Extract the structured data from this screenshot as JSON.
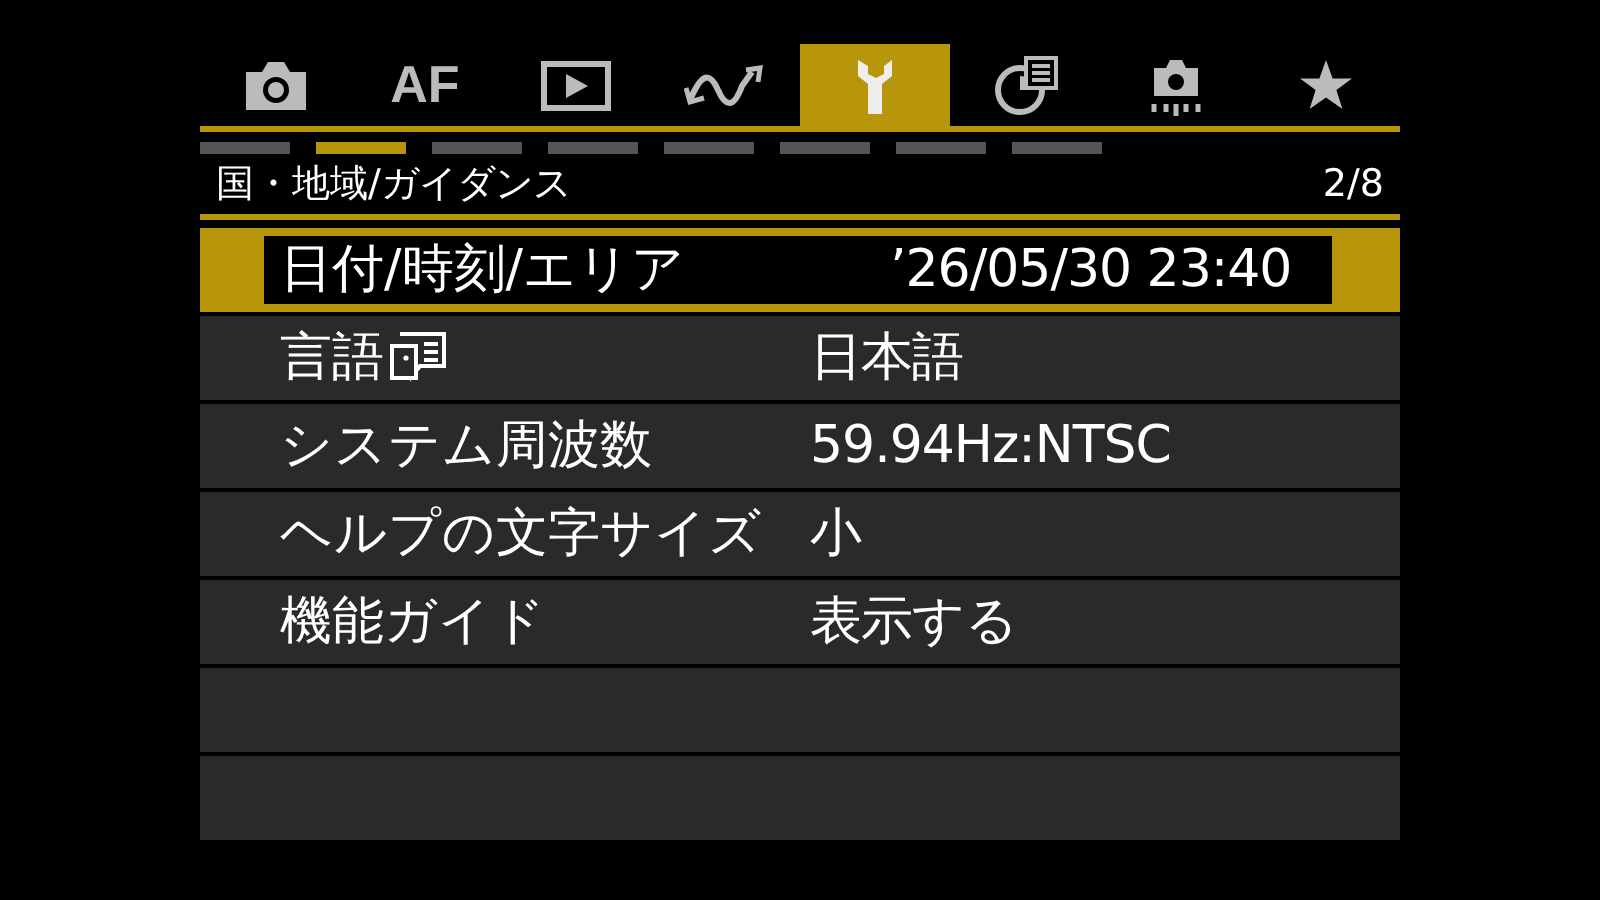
{
  "tabs": [
    {
      "kind": "camera",
      "selected": false
    },
    {
      "kind": "text",
      "label": "AF",
      "selected": false
    },
    {
      "kind": "playback",
      "selected": false
    },
    {
      "kind": "wave",
      "selected": false
    },
    {
      "kind": "wrench",
      "selected": true
    },
    {
      "kind": "network",
      "selected": false
    },
    {
      "kind": "sensor",
      "selected": false
    },
    {
      "kind": "star",
      "selected": false
    }
  ],
  "pages": [
    {
      "selected": false
    },
    {
      "selected": true
    },
    {
      "selected": false
    },
    {
      "selected": false
    },
    {
      "selected": false
    },
    {
      "selected": false
    },
    {
      "selected": false
    },
    {
      "selected": false
    }
  ],
  "section": {
    "title": "国・地域/ガイダンス",
    "page_number": "2/8"
  },
  "rows": [
    {
      "label": "日付/時刻/エリア",
      "kind": "plain",
      "value": "’26/05/30 23:40",
      "selected": true
    },
    {
      "label": "言語",
      "kind": "with_icon",
      "value": "日本語",
      "selected": false
    },
    {
      "label": "システム周波数",
      "kind": "plain",
      "value": "59.94Hz:NTSC",
      "selected": false
    },
    {
      "label": "ヘルプの文字サイズ",
      "kind": "plain",
      "value": "小",
      "selected": false
    },
    {
      "label": "機能ガイド",
      "kind": "plain",
      "value": "表示する",
      "selected": false
    }
  ]
}
